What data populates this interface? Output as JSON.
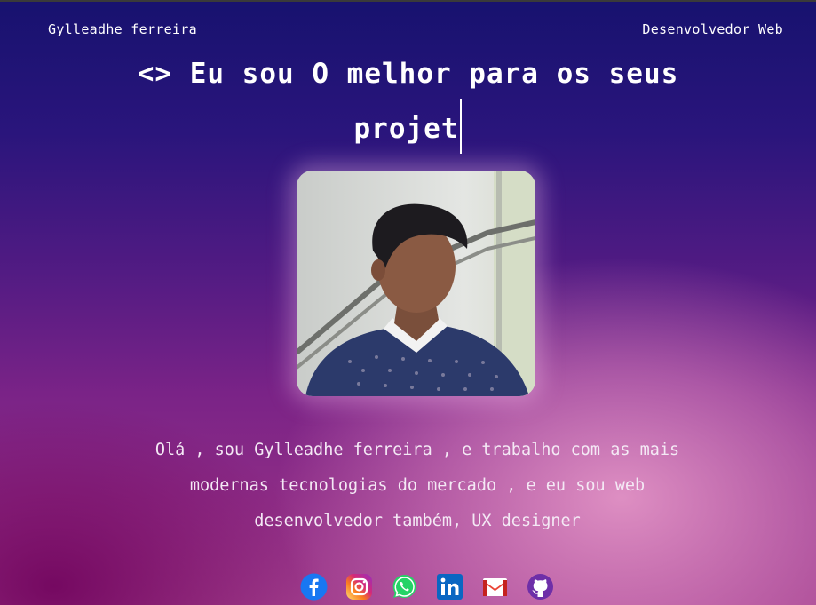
{
  "header": {
    "name": "Gylleadhe ferreira",
    "role": "Desenvolvedor Web"
  },
  "hero": {
    "headline_line1": "<> Eu sou O melhor para os seus",
    "headline_line2": "projet"
  },
  "intro": {
    "line1": "Olá , sou Gylleadhe ferreira , e trabalho com as mais",
    "line2": "modernas tecnologias do mercado , e eu sou web",
    "line3": "desenvolvedor também, UX designer"
  },
  "social": [
    {
      "icon": "facebook-icon",
      "color": "#1877f2"
    },
    {
      "icon": "instagram-icon",
      "color": "#e4405f"
    },
    {
      "icon": "whatsapp-icon",
      "color": "#25d366"
    },
    {
      "icon": "linkedin-icon",
      "color": "#0a66c2"
    },
    {
      "icon": "gmail-icon",
      "color": "#ea4335"
    },
    {
      "icon": "github-icon",
      "color": "#6e2fa8"
    }
  ]
}
